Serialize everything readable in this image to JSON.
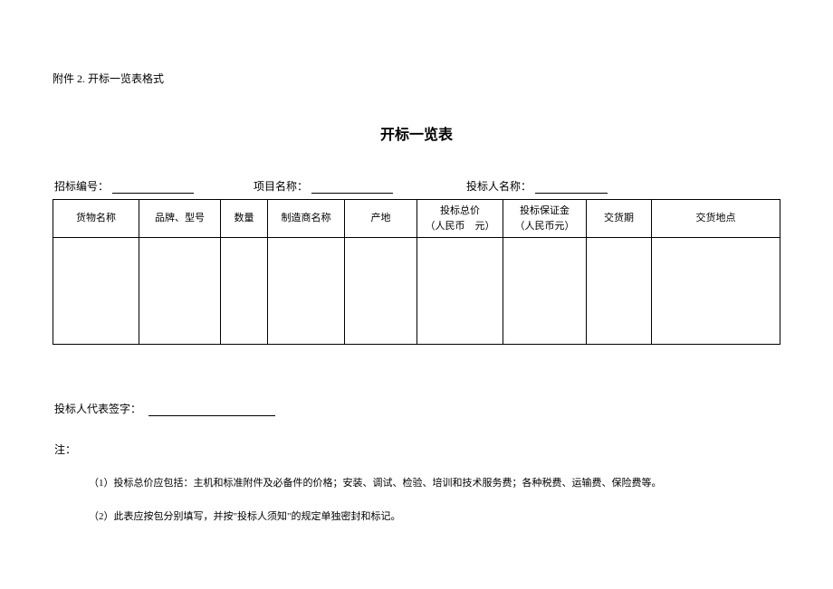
{
  "attachment": "附件 2. 开标一览表格式",
  "title": "开标一览表",
  "fields": {
    "bid_no_label": "招标编号：",
    "project_name_label": "项目名称：",
    "bidder_name_label": "投标人名称："
  },
  "table": {
    "headers": {
      "goods_name": "货物名称",
      "brand_model": "品牌、型号",
      "quantity": "数量",
      "manufacturer": "制造商名称",
      "origin": "产地",
      "total_price_l1": "投标总价",
      "total_price_l2": "（人民币　元）",
      "deposit_l1": "投标保证金",
      "deposit_l2": "（人民币元）",
      "delivery_period": "交货期",
      "delivery_place": "交货地点"
    }
  },
  "sign": {
    "label": "投标人代表签字："
  },
  "notes": {
    "label": "注：",
    "n1": "（1）投标总价应包括：主机和标准附件及必备件的价格；安装、调试、检验、培训和技术服务费；各种税费、运输费、保险费等。",
    "n2": "（2）此表应按包分别填写，并按\"投标人须知\"的规定单独密封和标记。"
  }
}
